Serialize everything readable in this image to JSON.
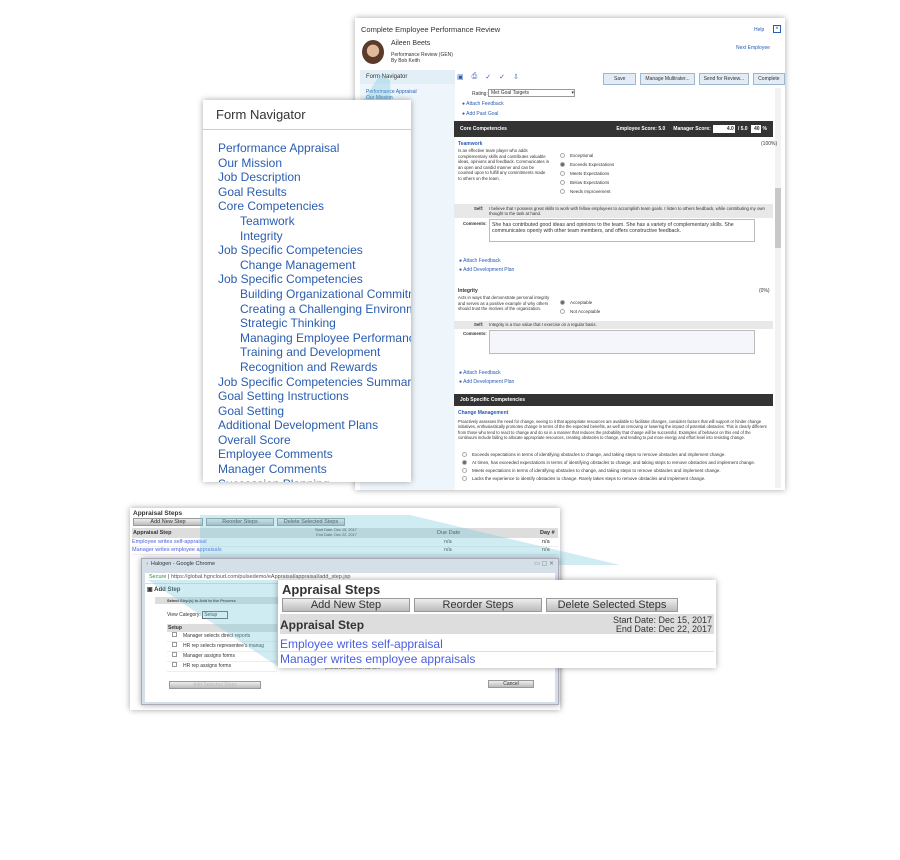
{
  "review": {
    "title": "Complete Employee Performance Review",
    "help": "Help",
    "employee_name": "Aileen Beets",
    "form_name": "Performance Review (GEN)",
    "by": "By Bob Keith",
    "next_employee": "Next Employee",
    "navigator_label": "Form Navigator",
    "nav_preview": [
      "Performance Appraisal",
      "Our Mission"
    ],
    "buttons": {
      "save": "Save",
      "manage": "Manage Multirater...",
      "send": "Send for Review...",
      "complete": "Complete"
    },
    "rating_label": "Rating:",
    "rating_value": "Met Goal Targets",
    "attach_feedback": "Attach Feedback",
    "add_past_goal": "Add Past Goal",
    "core": {
      "title": "Core Competencies",
      "employee_score": "Employee Score: 5.0",
      "manager_score_label": "Manager Score:",
      "manager_score": "4.0",
      "of": "/ 5.0",
      "percent": "40",
      "pct_sign": "%"
    },
    "teamwork": {
      "title": "Teamwork",
      "weight": "(100%)",
      "desc": "Is an effective team player who adds complementary skills and contributes valuable ideas, opinions and feedback. Communicates in an open and candid manner and can be counted upon to fulfill any commitments made to others on the team.",
      "options": [
        "Exceptional",
        "Exceeds Expectations",
        "Meets Expectations",
        "Below Expectations",
        "Needs Improvement"
      ],
      "selected": 1,
      "self_label": "Self:",
      "self": "I believe that I possess great skills to work with fellow employees to accomplish team goals. I listen to others feedback, while contributing my own thought to the task at hand.",
      "comments_label": "Comments:",
      "comments": "She has contributed good ideas and opinions to the team. She has a variety of complementary skills.  She communicates openly with other team members, and offers constructive feedback."
    },
    "add_dev_plan": "Add Development Plan",
    "integrity": {
      "title": "Integrity",
      "weight": "(0%)",
      "desc": "Acts in ways that demonstrate personal integrity and serves as a positive example of why others should trust the motives of the organization.",
      "options": [
        "Acceptable",
        "Not Acceptable"
      ],
      "selected": 0,
      "self": "Integrity is a true value that I exercise on a regular basis."
    },
    "job": {
      "title": "Job Specific Competencies",
      "sub": "Change Management",
      "desc": "Proactively assesses the need for change, seeing to it that appropriate resources are available to facilitate changes, considers factors that will support or hinder change initiatives, enthusiastically promotes change in terms of the the expected benefits, as well as removing or lowering the impact of potential obstacles. This is clearly different from those who tend to react to change and do so in a manner that reduces the probability that change will be successful. Examples of behavior on this end of the continuum include failing to allocate appropriate resources, creating obstacles to change, and tending to put more energy and effort level into resisting change.",
      "options": [
        "Exceeds expectations in terms of identifying obstacles to change, and taking steps to remove obstacles and implement change.",
        "At times, has exceeded expectations in terms of identifying obstacles to change, and taking steps to remove obstacles and implement change.",
        "Meets expectations in terms of identifying obstacles to change, and taking steps to remove obstacles and implement change.",
        "Lacks the experience to identify obstacles to change. Rarely takes steps to remove obstacles and implement change."
      ],
      "selected": 1
    }
  },
  "navigator": {
    "title": "Form Navigator",
    "items": [
      {
        "label": "Performance Appraisal",
        "indent": false
      },
      {
        "label": "Our Mission",
        "indent": false
      },
      {
        "label": "Job Description",
        "indent": false
      },
      {
        "label": "Goal Results",
        "indent": false
      },
      {
        "label": "Core Competencies",
        "indent": false
      },
      {
        "label": "Teamwork",
        "indent": true
      },
      {
        "label": "Integrity",
        "indent": true
      },
      {
        "label": "Job Specific Competencies",
        "indent": false
      },
      {
        "label": "Change Management",
        "indent": true
      },
      {
        "label": "Job Specific Competencies",
        "indent": false
      },
      {
        "label": "Building Organizational Commitme",
        "indent": true
      },
      {
        "label": "Creating a Challenging Environme",
        "indent": true
      },
      {
        "label": "Strategic Thinking",
        "indent": true
      },
      {
        "label": "Managing Employee Performance",
        "indent": true
      },
      {
        "label": "Training and Development",
        "indent": true
      },
      {
        "label": "Recognition and Rewards",
        "indent": true
      },
      {
        "label": "Job Specific Competencies Summary",
        "indent": false
      },
      {
        "label": "Goal Setting Instructions",
        "indent": false
      },
      {
        "label": "Goal Setting",
        "indent": false
      },
      {
        "label": "Additional Development Plans",
        "indent": false
      },
      {
        "label": "Overall Score",
        "indent": false
      },
      {
        "label": "Employee Comments",
        "indent": false
      },
      {
        "label": "Manager Comments",
        "indent": false
      },
      {
        "label": "Succession Planning",
        "indent": false
      }
    ]
  },
  "steps": {
    "title": "Appraisal Steps",
    "add": "Add New Step",
    "reorder": "Reorder Steps",
    "delete": "Delete Selected Steps",
    "col_step": "Appraisal Step",
    "start": "Start Date: Dec 15, 2017",
    "end": "End Date: Dec 22, 2017",
    "col_due": "Due Date",
    "col_day": "Day #",
    "rows": [
      {
        "step": "Employee writes self-appraisal",
        "due": "n/a",
        "day": "n/a"
      },
      {
        "step": "Manager writes employee appraisals",
        "due": "n/a",
        "day": "n/a"
      }
    ]
  },
  "chrome": {
    "title": "Halogen - Google Chrome",
    "secure": "Secure",
    "url": "https://global.hgncloud.com/pulsedemo/eAppraisal/appraisal/add_step.jsp",
    "dialog_title": "Add Step",
    "instruction": "Select Step(s) to Add to the Process",
    "view_category_label": "View Category:",
    "view_category": "Setup",
    "group": "Setup",
    "items": [
      "Manager selects direct reports",
      "HR rep selects representee's manag",
      "Manager assigns forms",
      "HR rep assigns forms"
    ],
    "note": "process has more than one form.",
    "add_selected": "Add Selected Steps",
    "cancel": "Cancel"
  }
}
